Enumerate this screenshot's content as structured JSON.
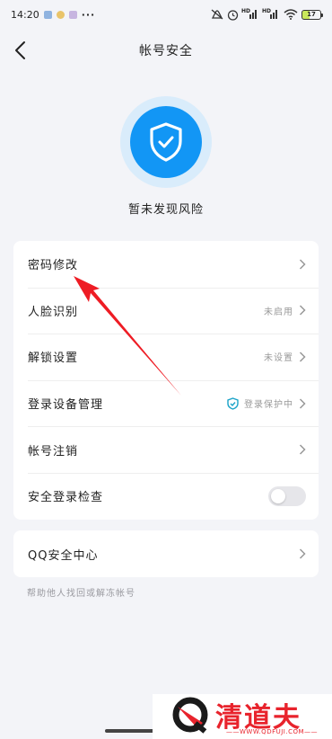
{
  "status_bar": {
    "time": "14:20",
    "dots": "···",
    "signal1_tag": "HD",
    "signal2_tag": "HD",
    "battery": "17"
  },
  "header": {
    "title": "帐号安全"
  },
  "security": {
    "status_text": "暂未发现风险",
    "accent_color": "#1296f5"
  },
  "settings": {
    "password_change": "密码修改",
    "face_id": {
      "label": "人脸识别",
      "status": "未启用"
    },
    "unlock": {
      "label": "解锁设置",
      "status": "未设置"
    },
    "devices": {
      "label": "登录设备管理",
      "status": "登录保护中"
    },
    "cancel_account": {
      "label": "帐号注销"
    },
    "safe_login_check": {
      "label": "安全登录检查",
      "enabled": false
    }
  },
  "qq_security": {
    "label": "QQ安全中心"
  },
  "help_text": "帮助他人找回或解冻帐号",
  "watermark": {
    "text": "清道夫",
    "url": "——WWW.QDFUJI.COM——"
  }
}
